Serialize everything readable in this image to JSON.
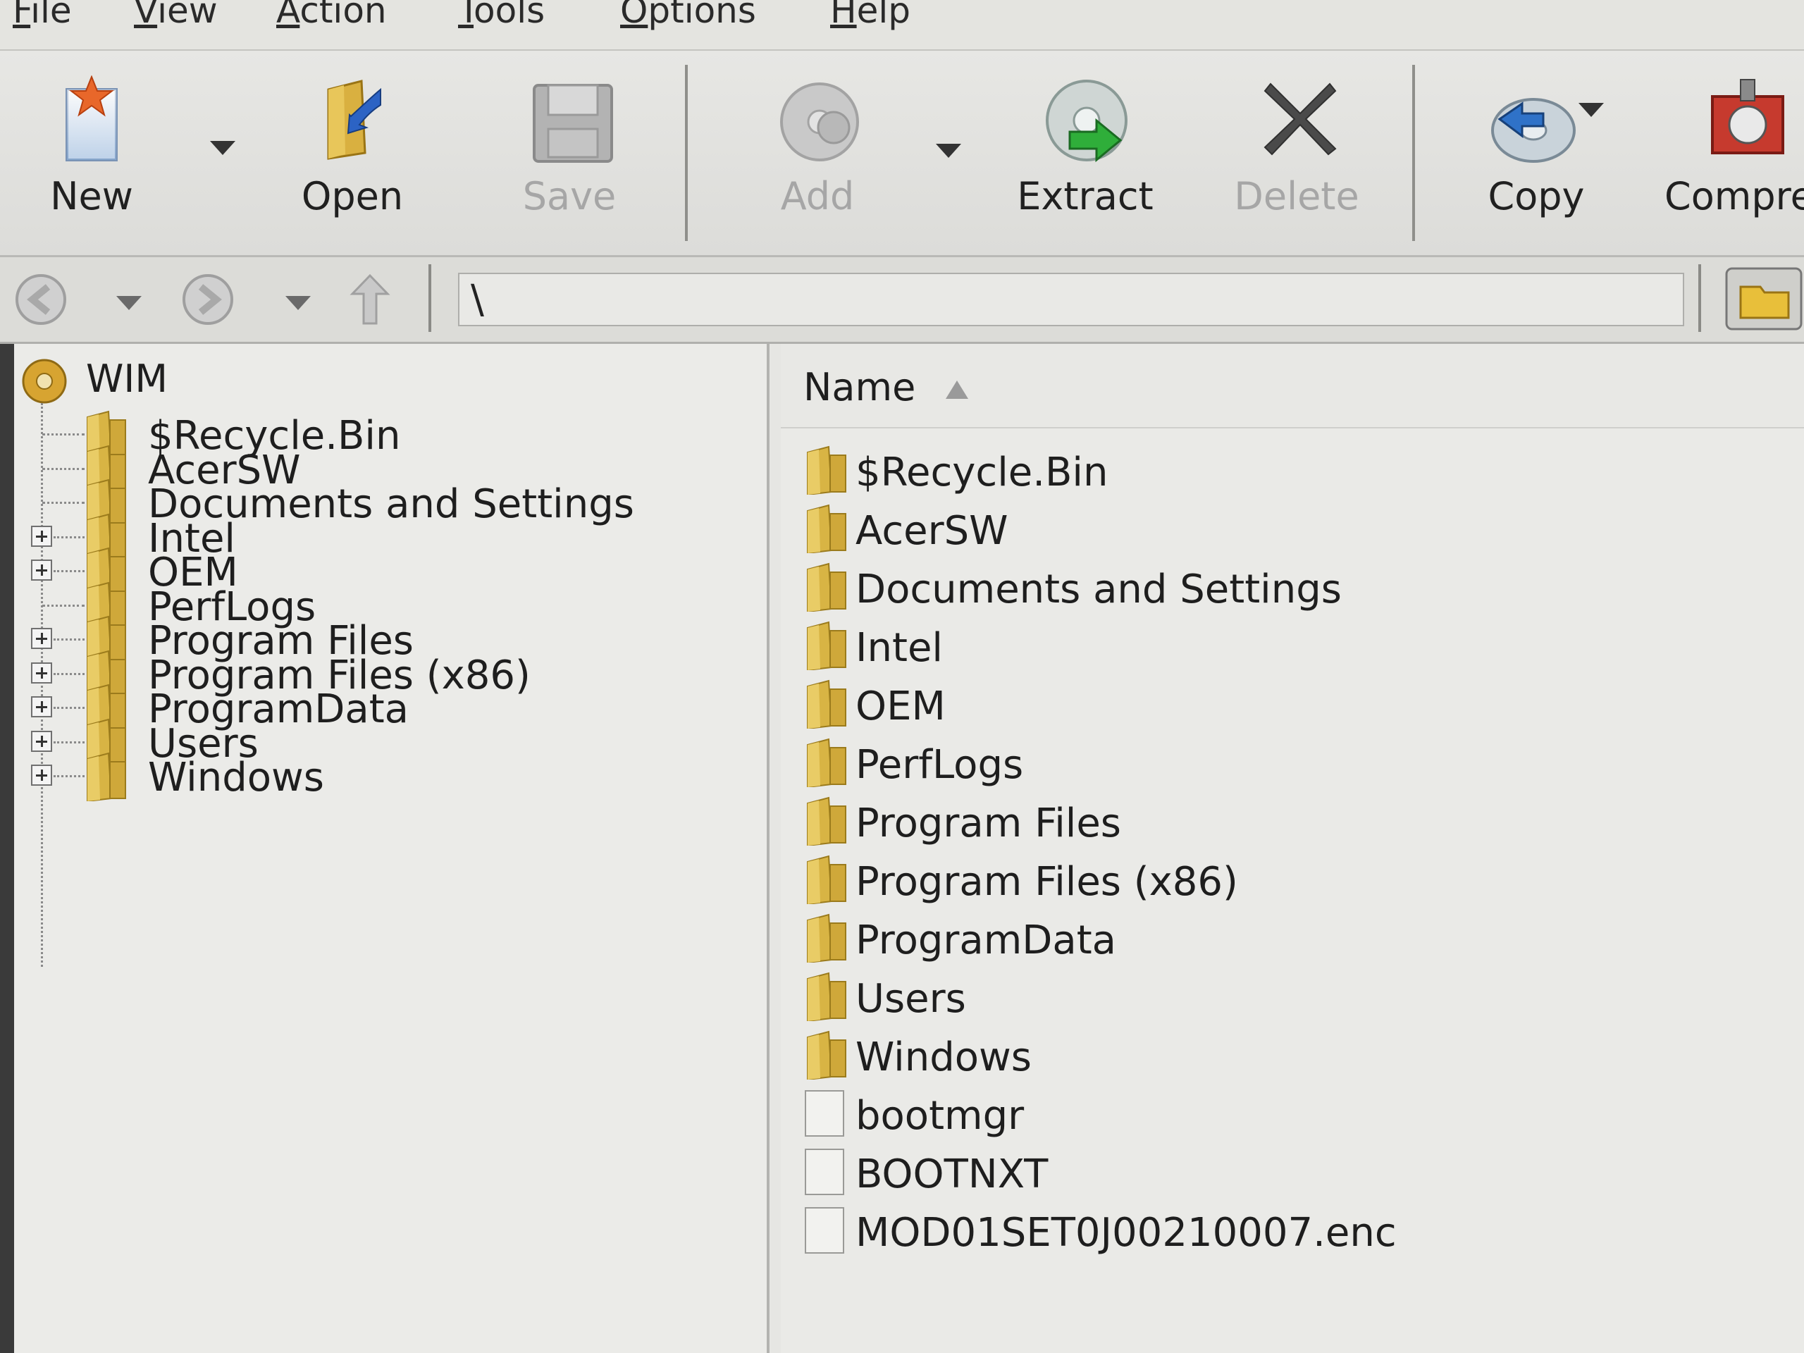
{
  "menubar": {
    "items": [
      {
        "accel": "F",
        "rest": "ile"
      },
      {
        "accel": "V",
        "rest": "iew"
      },
      {
        "accel": "A",
        "rest": "ction"
      },
      {
        "accel": "T",
        "rest": "ools"
      },
      {
        "accel": "O",
        "rest": "ptions"
      },
      {
        "accel": "H",
        "rest": "elp"
      }
    ]
  },
  "toolbar": {
    "new": "New",
    "open": "Open",
    "save": "Save",
    "add": "Add",
    "extract": "Extract",
    "delete": "Delete",
    "copy": "Copy",
    "compress": "Compres"
  },
  "address": {
    "path": "\\"
  },
  "tree": {
    "root": "WIM",
    "items": [
      {
        "label": "$Recycle.Bin",
        "expandable": false
      },
      {
        "label": "AcerSW",
        "expandable": false
      },
      {
        "label": "Documents and Settings",
        "expandable": false
      },
      {
        "label": "Intel",
        "expandable": true
      },
      {
        "label": "OEM",
        "expandable": true
      },
      {
        "label": "PerfLogs",
        "expandable": false
      },
      {
        "label": "Program Files",
        "expandable": true
      },
      {
        "label": "Program Files (x86)",
        "expandable": true
      },
      {
        "label": "ProgramData",
        "expandable": true
      },
      {
        "label": "Users",
        "expandable": true
      },
      {
        "label": "Windows",
        "expandable": true
      }
    ]
  },
  "list": {
    "column_name": "Name",
    "items": [
      {
        "label": "$Recycle.Bin",
        "type": "folder"
      },
      {
        "label": "AcerSW",
        "type": "folder"
      },
      {
        "label": "Documents and Settings",
        "type": "folder"
      },
      {
        "label": "Intel",
        "type": "folder"
      },
      {
        "label": "OEM",
        "type": "folder"
      },
      {
        "label": "PerfLogs",
        "type": "folder"
      },
      {
        "label": "Program Files",
        "type": "folder"
      },
      {
        "label": "Program Files (x86)",
        "type": "folder"
      },
      {
        "label": "ProgramData",
        "type": "folder"
      },
      {
        "label": "Users",
        "type": "folder"
      },
      {
        "label": "Windows",
        "type": "folder"
      },
      {
        "label": "bootmgr",
        "type": "file"
      },
      {
        "label": "BOOTNXT",
        "type": "file"
      },
      {
        "label": "MOD01SET0J00210007.enc",
        "type": "file"
      }
    ]
  }
}
